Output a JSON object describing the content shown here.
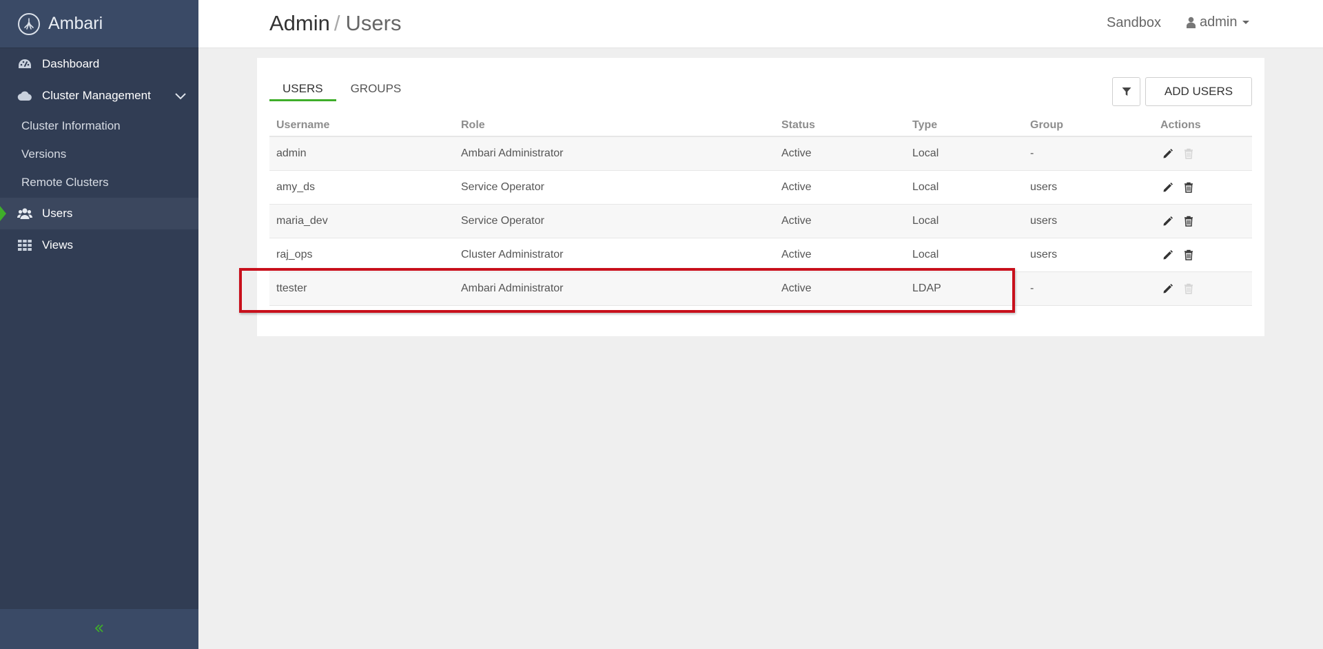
{
  "app": {
    "name": "Ambari"
  },
  "sidebar": {
    "items": [
      {
        "label": "Dashboard",
        "icon": "dashboard-icon"
      },
      {
        "label": "Cluster Management",
        "icon": "cloud-icon"
      },
      {
        "label": "Users",
        "icon": "users-icon",
        "active": true
      },
      {
        "label": "Views",
        "icon": "grid-icon"
      }
    ],
    "cluster_management_children": [
      {
        "label": "Cluster Information"
      },
      {
        "label": "Versions"
      },
      {
        "label": "Remote Clusters"
      }
    ],
    "collapse_icon": "double-chevron-left-icon"
  },
  "header": {
    "breadcrumb": {
      "root": "Admin",
      "separator": "/",
      "current": "Users"
    },
    "cluster_name": "Sandbox",
    "user_menu_label": "admin"
  },
  "content": {
    "tabs": [
      {
        "label": "USERS",
        "active": true
      },
      {
        "label": "GROUPS",
        "active": false
      }
    ],
    "filter_icon": "filter-icon",
    "add_button_label": "ADD USERS",
    "table": {
      "columns": [
        "Username",
        "Role",
        "Status",
        "Type",
        "Group",
        "Actions"
      ],
      "rows": [
        {
          "username": "admin",
          "role": "Ambari Administrator",
          "status": "Active",
          "type": "Local",
          "group": "-",
          "delete_enabled": false
        },
        {
          "username": "amy_ds",
          "role": "Service Operator",
          "status": "Active",
          "type": "Local",
          "group": "users",
          "delete_enabled": true
        },
        {
          "username": "maria_dev",
          "role": "Service Operator",
          "status": "Active",
          "type": "Local",
          "group": "users",
          "delete_enabled": true
        },
        {
          "username": "raj_ops",
          "role": "Cluster Administrator",
          "status": "Active",
          "type": "Local",
          "group": "users",
          "delete_enabled": true
        },
        {
          "username": "ttester",
          "role": "Ambari Administrator",
          "status": "Active",
          "type": "LDAP",
          "group": "-",
          "delete_enabled": false
        }
      ]
    }
  },
  "colors": {
    "sidebar_bg": "#313d54",
    "accent_green": "#3fae2a",
    "highlight_red": "#c8101c"
  }
}
